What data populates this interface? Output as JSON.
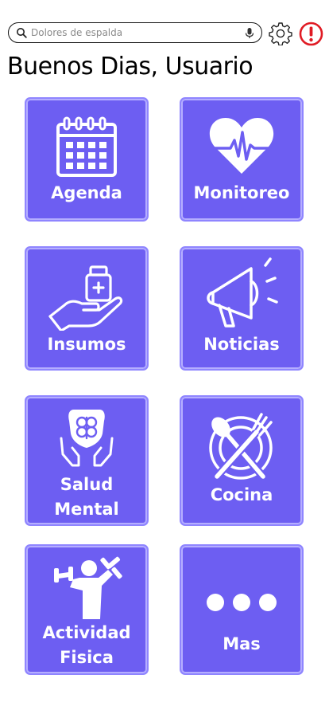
{
  "search": {
    "placeholder": "Dolores de espalda"
  },
  "greeting": "Buenos Dias, Usuario",
  "icons": {
    "settings": "gear-icon",
    "alert": "alert-icon",
    "search": "search-icon",
    "mic": "microphone-icon"
  },
  "colors": {
    "tile": "#6d5ef2",
    "tile_border": "#8f85ff",
    "alert": "#e01b24"
  },
  "tiles": [
    {
      "label": "Agenda",
      "icon": "calendar-icon"
    },
    {
      "label": "Monitoreo",
      "icon": "heart-pulse-icon"
    },
    {
      "label": "Insumos",
      "icon": "hand-medicine-icon"
    },
    {
      "label": "Noticias",
      "icon": "megaphone-icon"
    },
    {
      "label_line1": "Salud",
      "label_line2": "Mental",
      "icon": "brain-hands-icon"
    },
    {
      "label": "Cocina",
      "icon": "plate-cutlery-icon"
    },
    {
      "label_line1": "Actividad",
      "label_line2": "Fisica",
      "icon": "dumbbell-person-icon"
    },
    {
      "label": "Mas",
      "icon": "more-dots-icon"
    }
  ]
}
